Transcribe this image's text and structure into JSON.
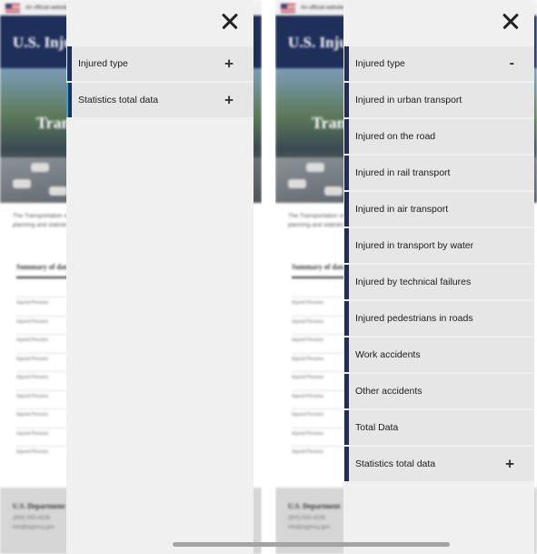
{
  "background": {
    "gov_banner": "An official website of the United States government",
    "site_title": "U.S. Injured",
    "hero_title": "Transportation",
    "intro": "The Transportation statistics office is the main resource of statutory responsibility for planning and statistics on transportation systems.",
    "summary_heading": "Summary of data",
    "row_label": "Injured Persons",
    "footer": {
      "name": "U.S. Department",
      "phone": "(800) 555-4235",
      "email": "info@agency.gov"
    }
  },
  "left_panel": {
    "close_icon": "close-icon",
    "items": [
      {
        "label": "Injured type",
        "symbol": "+"
      },
      {
        "label": "Statistics total data",
        "symbol": "+"
      }
    ]
  },
  "right_panel": {
    "close_icon": "close-icon",
    "items": [
      {
        "label": "Injured type",
        "symbol": "-"
      },
      {
        "label": "Injured in urban transport",
        "symbol": ""
      },
      {
        "label": "Injured on the road",
        "symbol": ""
      },
      {
        "label": "Injured in rail transport",
        "symbol": ""
      },
      {
        "label": "Injured in air transport",
        "symbol": ""
      },
      {
        "label": "Injured in transport by water",
        "symbol": ""
      },
      {
        "label": "Injured by technical failures",
        "symbol": ""
      },
      {
        "label": "Injured pedestrians in roads",
        "symbol": ""
      },
      {
        "label": "Work accidents",
        "symbol": ""
      },
      {
        "label": "Other accidents",
        "symbol": ""
      },
      {
        "label": "Total Data",
        "symbol": ""
      },
      {
        "label": "Statistics total data",
        "symbol": "+"
      }
    ]
  },
  "colors": {
    "accent": "#1e2f5a",
    "focus_ring": "#29a8e0",
    "drawer_bg": "#f0f0f0",
    "item_bg": "#e6e6e6"
  }
}
